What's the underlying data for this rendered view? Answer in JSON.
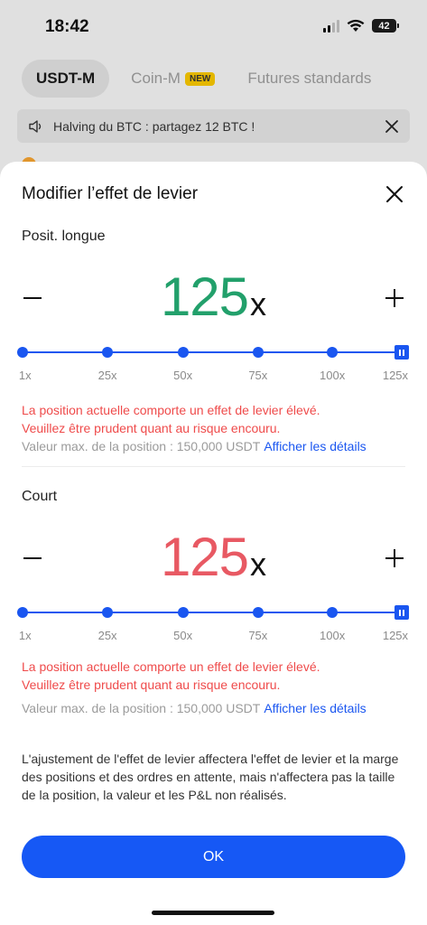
{
  "status": {
    "time": "18:42",
    "battery": "42"
  },
  "background": {
    "tabs": [
      {
        "label": "USDT-M",
        "active": true
      },
      {
        "label": "Coin-M",
        "badge": "NEW"
      },
      {
        "label": "Futures standards"
      }
    ],
    "banner": "Halving du BTC : partagez 12 BTC !"
  },
  "sheet": {
    "title": "Modifier l’effet de levier",
    "long": {
      "label": "Posit. longue",
      "value": "125",
      "suffix": "x",
      "warning_line1": "La position actuelle comporte un effet de levier élevé.",
      "warning_line2": "Veuillez être prudent quant au risque encouru.",
      "maxpos": "Valeur max. de la position : 150,000 USDT",
      "details": "Afficher les détails"
    },
    "short": {
      "label": "Court",
      "value": "125",
      "suffix": "x",
      "warning_line1": "La position actuelle comporte un effet de levier élevé.",
      "warning_line2": "Veuillez être prudent quant au risque encouru.",
      "maxpos": "Valeur max. de la position : 150,000 USDT",
      "details": "Afficher les détails"
    },
    "ticks": [
      "1x",
      "25x",
      "50x",
      "75x",
      "100x",
      "125x"
    ],
    "note": "L'ajustement de l'effet de levier affectera l'effet de levier et la marge des positions et des ordres en attente, mais n'affectera pas la taille de la position, la valeur et les P&L non réalisés.",
    "ok_label": "OK"
  },
  "colors": {
    "accent": "#1658f5",
    "long": "#22a06b",
    "short": "#e85963",
    "warning": "#ef4b4b"
  },
  "icons": {
    "close": "close-icon",
    "minus": "minus-icon",
    "plus": "plus-icon",
    "speaker": "speaker-icon",
    "wifi": "wifi-icon",
    "signal": "signal-icon"
  }
}
